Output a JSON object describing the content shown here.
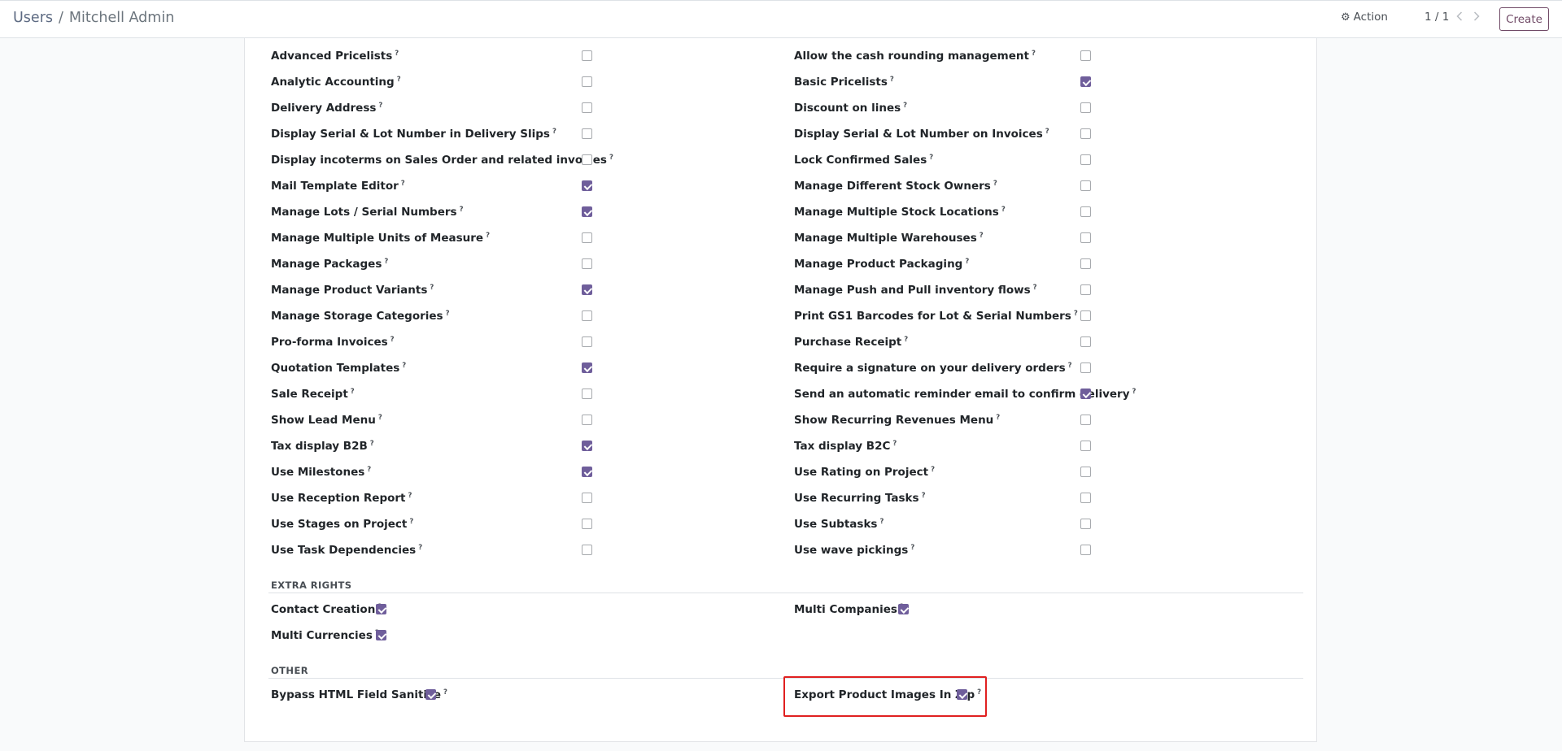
{
  "breadcrumb": {
    "parent": "Users",
    "separator": "/",
    "current": "Mitchell Admin"
  },
  "toolbar": {
    "action_icon": "gear-icon",
    "action_label": "Action",
    "pager_value": "1 / 1",
    "create_label": "Create"
  },
  "icons": {
    "prev": "chevron-left-icon",
    "next": "chevron-right-icon",
    "help": "?"
  },
  "technical_settings": {
    "left": [
      {
        "label": "Advanced Pricelists",
        "checked": false
      },
      {
        "label": "Analytic Accounting",
        "checked": false
      },
      {
        "label": "Delivery Address",
        "checked": false
      },
      {
        "label": "Display Serial & Lot Number in Delivery Slips",
        "checked": false
      },
      {
        "label": "Display incoterms on Sales Order and related invoices",
        "checked": false
      },
      {
        "label": "Mail Template Editor",
        "checked": true
      },
      {
        "label": "Manage Lots / Serial Numbers",
        "checked": true
      },
      {
        "label": "Manage Multiple Units of Measure",
        "checked": false
      },
      {
        "label": "Manage Packages",
        "checked": false
      },
      {
        "label": "Manage Product Variants",
        "checked": true
      },
      {
        "label": "Manage Storage Categories",
        "checked": false
      },
      {
        "label": "Pro-forma Invoices",
        "checked": false
      },
      {
        "label": "Quotation Templates",
        "checked": true
      },
      {
        "label": "Sale Receipt",
        "checked": false
      },
      {
        "label": "Show Lead Menu",
        "checked": false
      },
      {
        "label": "Tax display B2B",
        "checked": true
      },
      {
        "label": "Use Milestones",
        "checked": true
      },
      {
        "label": "Use Reception Report",
        "checked": false
      },
      {
        "label": "Use Stages on Project",
        "checked": false
      },
      {
        "label": "Use Task Dependencies",
        "checked": false
      }
    ],
    "right": [
      {
        "label": "Allow the cash rounding management",
        "checked": false
      },
      {
        "label": "Basic Pricelists",
        "checked": true
      },
      {
        "label": "Discount on lines",
        "checked": false
      },
      {
        "label": "Display Serial & Lot Number on Invoices",
        "checked": false
      },
      {
        "label": "Lock Confirmed Sales",
        "checked": false
      },
      {
        "label": "Manage Different Stock Owners",
        "checked": false
      },
      {
        "label": "Manage Multiple Stock Locations",
        "checked": false
      },
      {
        "label": "Manage Multiple Warehouses",
        "checked": false
      },
      {
        "label": "Manage Product Packaging",
        "checked": false
      },
      {
        "label": "Manage Push and Pull inventory flows",
        "checked": false
      },
      {
        "label": "Print GS1 Barcodes for Lot & Serial Numbers",
        "checked": false
      },
      {
        "label": "Purchase Receipt",
        "checked": false
      },
      {
        "label": "Require a signature on your delivery orders",
        "checked": false
      },
      {
        "label": "Send an automatic reminder email to confirm delivery",
        "checked": true
      },
      {
        "label": "Show Recurring Revenues Menu",
        "checked": false
      },
      {
        "label": "Tax display B2C",
        "checked": false
      },
      {
        "label": "Use Rating on Project",
        "checked": false
      },
      {
        "label": "Use Recurring Tasks",
        "checked": false
      },
      {
        "label": "Use Subtasks",
        "checked": false
      },
      {
        "label": "Use wave pickings",
        "checked": false
      }
    ]
  },
  "extra_rights": {
    "title": "EXTRA RIGHTS",
    "items": [
      {
        "label": "Contact Creation",
        "checked": true
      },
      {
        "label": "Multi Companies",
        "checked": true
      },
      {
        "label": "Multi Currencies",
        "checked": true
      }
    ]
  },
  "other": {
    "title": "OTHER",
    "items": [
      {
        "label": "Bypass HTML Field Sanitize",
        "checked": true
      },
      {
        "label": "Export Product Images In Zip",
        "checked": true
      }
    ]
  },
  "colors": {
    "checkbox_checked": "#6f5e9b",
    "brand": "#714b67",
    "highlight": "#e02020"
  }
}
